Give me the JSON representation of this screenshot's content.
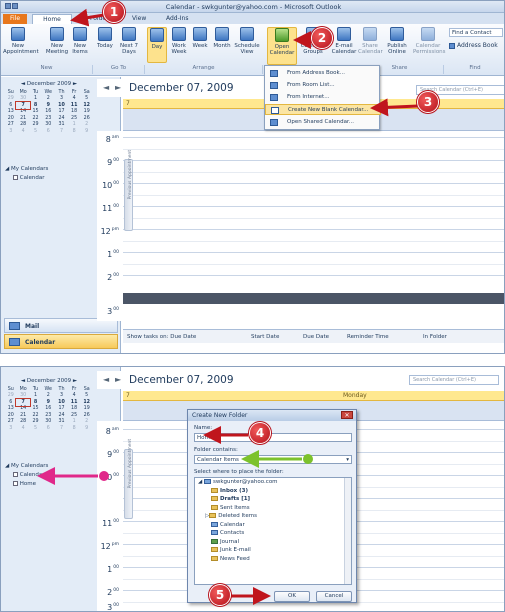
{
  "window": {
    "title": "Calendar - swkgunter@yahoo.com - Microsoft Outlook"
  },
  "ribbon_tabs": [
    "File",
    "Home",
    "Folder",
    "View",
    "Add-Ins"
  ],
  "ribbon": {
    "buttons": [
      {
        "label": "New\nAppointment"
      },
      {
        "label": "New\nMeeting"
      },
      {
        "label": "New\nItems"
      },
      {
        "label": "Today"
      },
      {
        "label": "Next 7\nDays"
      },
      {
        "label": "Day"
      },
      {
        "label": "Work\nWeek"
      },
      {
        "label": "Week"
      },
      {
        "label": "Month"
      },
      {
        "label": "Schedule\nView"
      },
      {
        "label": "Open\nCalendar"
      },
      {
        "label": "Calendar\nGroups"
      },
      {
        "label": "E-mail\nCalendar"
      },
      {
        "label": "Share\nCalendar"
      },
      {
        "label": "Publish\nOnline"
      },
      {
        "label": "Calendar\nPermissions"
      }
    ],
    "groups": [
      "New",
      "Go To",
      "Arrange",
      "Share",
      "Find"
    ],
    "find_contact": "Find a Contact",
    "address_book": "Address Book"
  },
  "open_calendar_menu": [
    "From Address Book...",
    "From Room List...",
    "From Internet...",
    "Create New Blank Calendar...",
    "Open Shared Calendar..."
  ],
  "mini_calendar": {
    "month": "December 2009",
    "weekdays": [
      "Su",
      "Mo",
      "Tu",
      "We",
      "Th",
      "Fr",
      "Sa"
    ],
    "weeks": [
      [
        "29",
        "30",
        "1",
        "2",
        "3",
        "4",
        "5"
      ],
      [
        "6",
        "7",
        "8",
        "9",
        "10",
        "11",
        "12"
      ],
      [
        "13",
        "14",
        "15",
        "16",
        "17",
        "18",
        "19"
      ],
      [
        "20",
        "21",
        "22",
        "23",
        "24",
        "25",
        "26"
      ],
      [
        "27",
        "28",
        "29",
        "30",
        "31",
        "1",
        "2"
      ],
      [
        "3",
        "4",
        "5",
        "6",
        "7",
        "8",
        "9"
      ]
    ]
  },
  "nav": {
    "my_calendars_1": "My Calendars",
    "calendar": "Calendar",
    "my_calendars_2": "My Calendars",
    "home": "Home",
    "mail": "Mail",
    "calendar_btn": "Calendar"
  },
  "calendar": {
    "date_heading": "December 07, 2009",
    "search_placeholder": "Search Calendar (Ctrl+E)",
    "day_number": "7",
    "day_name": "Monday",
    "times1": [
      [
        "8",
        "am"
      ],
      [
        "9",
        "00"
      ],
      [
        "10",
        "00"
      ],
      [
        "11",
        "00"
      ],
      [
        "12",
        "pm"
      ],
      [
        "1",
        "00"
      ],
      [
        "2",
        "00"
      ],
      [
        "3",
        "00"
      ]
    ],
    "times2": [
      [
        "8",
        "am"
      ],
      [
        "9",
        "00"
      ],
      [
        "10",
        "00"
      ],
      [
        "11",
        "00"
      ],
      [
        "12",
        "pm"
      ],
      [
        "1",
        "00"
      ],
      [
        "2",
        "00"
      ],
      [
        "3",
        "00"
      ]
    ],
    "prev_appt": "Previous Appointment",
    "tasks_label": "Show tasks on: Due Date",
    "task_cols": [
      "Start Date",
      "Due Date",
      "Reminder Time",
      "In Folder"
    ]
  },
  "dialog": {
    "title": "Create New Folder",
    "name_label": "Name:",
    "name_value": "Home",
    "contains_label": "Folder contains:",
    "contains_value": "Calendar Items",
    "place_label": "Select where to place the folder:",
    "folders": [
      "swkgunter@yahoo.com",
      "Inbox (3)",
      "Drafts [1]",
      "Sent Items",
      "Deleted Items",
      "Calendar",
      "Contacts",
      "Journal",
      "Junk E-mail",
      "News Feed"
    ],
    "ok": "OK",
    "cancel": "Cancel"
  },
  "callouts": [
    "1",
    "2",
    "3",
    "4",
    "5"
  ],
  "colors": {
    "callout_red": "#c0151d",
    "arrow_green": "#7cc22c",
    "arrow_magenta": "#e0288a",
    "file_tab": "#e8771c",
    "highlight": "#fde28d"
  }
}
